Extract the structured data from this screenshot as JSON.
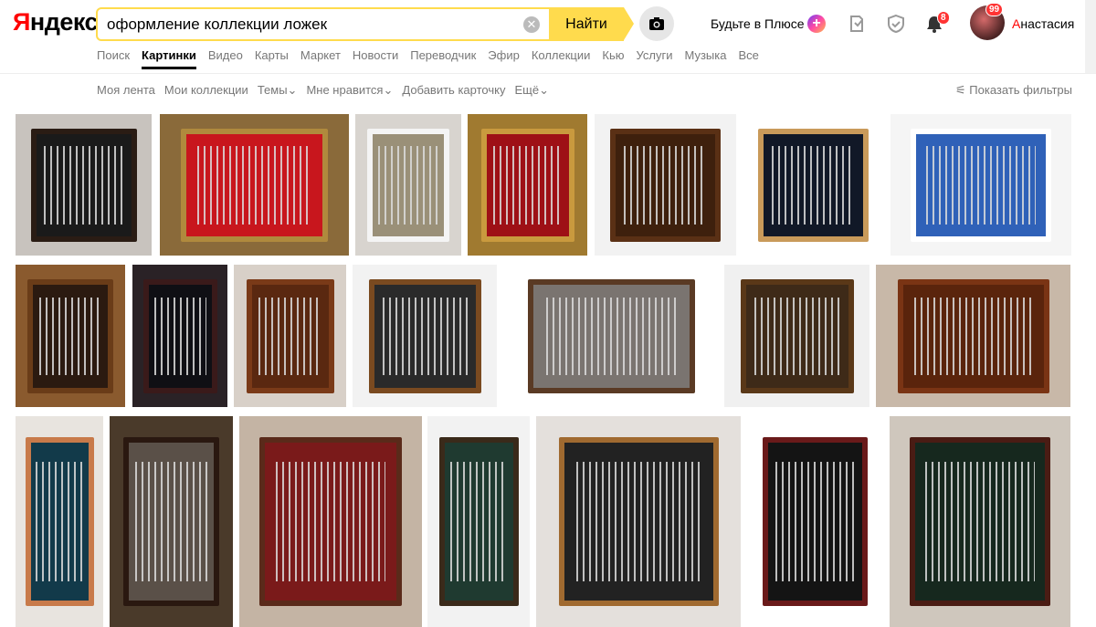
{
  "header": {
    "logo_first": "Я",
    "logo_rest": "ндекс",
    "search_value": "оформление коллекции ложек",
    "find_label": "Найти",
    "plus_label": "Будьте в Плюсе",
    "notifications_count": "8",
    "avatar_count": "99",
    "user_first": "А",
    "user_rest": "настасия"
  },
  "tabs": [
    "Поиск",
    "Картинки",
    "Видео",
    "Карты",
    "Маркет",
    "Новости",
    "Переводчик",
    "Эфир",
    "Коллекции",
    "Кью",
    "Услуги",
    "Музыка",
    "Все"
  ],
  "active_tab": "Картинки",
  "filters": [
    "Моя лента",
    "Мои коллекции",
    "Темы",
    "Мне нравится",
    "Добавить карточку",
    "Ещё"
  ],
  "show_filters": "Показать фильтры",
  "colors": {
    "accent": "#ffdb4d",
    "brand_red": "#ff0000",
    "badge": "#ff3333"
  },
  "results": [
    {
      "name": "wood-frame-black-bg",
      "bg": "#c8c3be",
      "frame": "#2a1c14",
      "inner": "#1a1a1a"
    },
    {
      "name": "gold-frame-red-bg",
      "bg": "#8a6a3a",
      "frame": "#b08a3d",
      "inner": "#c8161d"
    },
    {
      "name": "wall-multiple-frames",
      "bg": "#d8d4cf",
      "frame": "#f4f4f4",
      "inner": "#9a9078"
    },
    {
      "name": "gold-frame-red-bg-2",
      "bg": "#a07a30",
      "frame": "#c99a3e",
      "inner": "#9e1016"
    },
    {
      "name": "wood-rack-arch",
      "bg": "#f2f2f2",
      "frame": "#5a3015",
      "inner": "#3e200d"
    },
    {
      "name": "light-wood-shelf-black",
      "bg": "#ffffff",
      "frame": "#c99a5a",
      "inner": "#111827"
    },
    {
      "name": "white-frame-blue-bg",
      "bg": "#f5f5f5",
      "frame": "#ffffff",
      "inner": "#2f61b8"
    },
    {
      "name": "wood-shelf-figurines",
      "bg": "#8a5a2e",
      "frame": "#6a3c18",
      "inner": "#2b1a10"
    },
    {
      "name": "dark-frame-black-bg",
      "bg": "#2a2226",
      "frame": "#3a1a1a",
      "inner": "#0f0f14"
    },
    {
      "name": "carved-wood-rack",
      "bg": "#d8d0c8",
      "frame": "#7a3a18",
      "inner": "#5a2810"
    },
    {
      "name": "wood-frame-glass",
      "bg": "#f2f2f2",
      "frame": "#7a4a20",
      "inner": "#2a2a2a"
    },
    {
      "name": "grey-frame-spoons",
      "bg": "#ffffff",
      "frame": "#5a3a24",
      "inner": "#7a7470"
    },
    {
      "name": "tall-wood-shelf",
      "bg": "#f0f0f0",
      "frame": "#5a3818",
      "inner": "#3e2a18"
    },
    {
      "name": "shield-rack",
      "bg": "#c8b8a8",
      "frame": "#7a3414",
      "inner": "#5a240c"
    },
    {
      "name": "cabinet-with-door",
      "bg": "#e8e4df",
      "frame": "#c87a4a",
      "inner": "#123a4a"
    },
    {
      "name": "dark-cabinet-silver",
      "bg": "#4a3a2a",
      "frame": "#2a1810",
      "inner": "#5a5048"
    },
    {
      "name": "cabinet-red-bg",
      "bg": "#c4b4a4",
      "frame": "#5a2a1a",
      "inner": "#7a1a1a"
    },
    {
      "name": "green-bg-frame",
      "bg": "#f2f2f2",
      "frame": "#3a2a1a",
      "inner": "#1f3a30"
    },
    {
      "name": "wood-frame-figures",
      "bg": "#e4e0dc",
      "frame": "#a06a30",
      "inner": "#222"
    },
    {
      "name": "maroon-frame-black",
      "bg": "#ffffff",
      "frame": "#6a1a1a",
      "inner": "#141414"
    },
    {
      "name": "dark-cabinet-green",
      "bg": "#cfc7bd",
      "frame": "#4a1c14",
      "inner": "#16281e"
    }
  ]
}
